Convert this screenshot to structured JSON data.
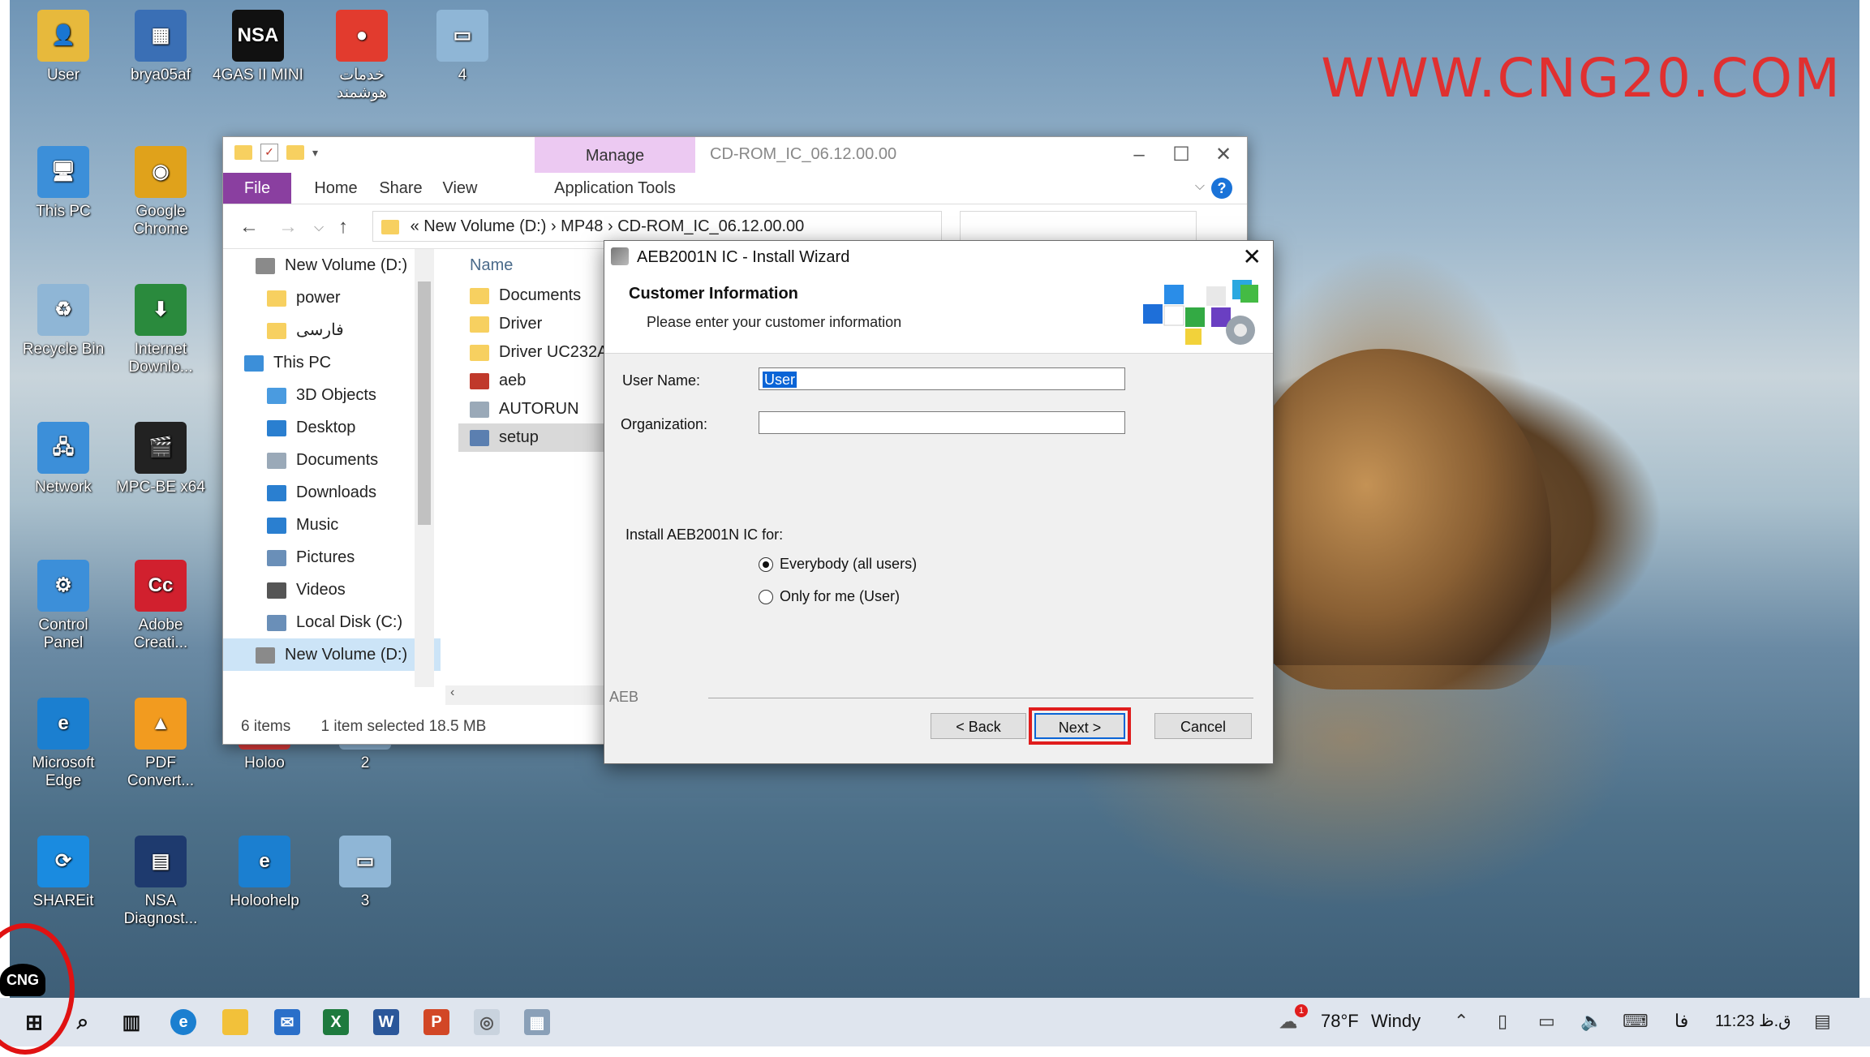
{
  "watermark": "WWW.CNG20.COM",
  "desktop": {
    "icons": [
      {
        "label": "User",
        "color": "#e7b93c",
        "glyph": "👤"
      },
      {
        "label": "brya05af",
        "color": "#3a6fb5",
        "glyph": "▦"
      },
      {
        "label": "4GAS II MINI",
        "color": "#111111",
        "glyph": "NSA"
      },
      {
        "label": "خدمات هوشمند",
        "color": "#e23b2e",
        "glyph": "●"
      },
      {
        "label": "4",
        "color": "#8fb6d6",
        "glyph": "▭"
      },
      {
        "label": "This PC",
        "color": "#3c8fd9",
        "glyph": "🖥"
      },
      {
        "label": "Google Chrome",
        "color": "#e0a21b",
        "glyph": "◉"
      },
      {
        "label": "Recycle Bin",
        "color": "#8fb6d6",
        "glyph": "♻"
      },
      {
        "label": "Internet Downlo...",
        "color": "#2a8a3d",
        "glyph": "⬇"
      },
      {
        "label": "Network",
        "color": "#3c8fd9",
        "glyph": "🖧"
      },
      {
        "label": "MPC-BE x64",
        "color": "#222222",
        "glyph": "🎬"
      },
      {
        "label": "Control Panel",
        "color": "#3c8fd9",
        "glyph": "⚙"
      },
      {
        "label": "Adobe Creati...",
        "color": "#d1202e",
        "glyph": "Cc"
      },
      {
        "label": "Microsoft Edge",
        "color": "#1b7fd0",
        "glyph": "e"
      },
      {
        "label": "PDF Convert...",
        "color": "#f29b1f",
        "glyph": "▲"
      },
      {
        "label": "Holoo",
        "color": "#e03c3c",
        "glyph": "●"
      },
      {
        "label": "2",
        "color": "#8fb6d6",
        "glyph": "▭"
      },
      {
        "label": "SHAREit",
        "color": "#1a8be0",
        "glyph": "⟳"
      },
      {
        "label": "NSA Diagnost...",
        "color": "#1e3a6e",
        "glyph": "▤"
      },
      {
        "label": "Holoohelp",
        "color": "#1b7fd0",
        "glyph": "e"
      },
      {
        "label": "3",
        "color": "#8fb6d6",
        "glyph": "▭"
      }
    ]
  },
  "explorer": {
    "title": "CD-ROM_IC_06.12.00.00",
    "manage_tab": "Manage",
    "ribbon_tabs": [
      "File",
      "Home",
      "Share",
      "View",
      "Application Tools"
    ],
    "address": "«  New Volume (D:)  ›  MP48  ›  CD-ROM_IC_06.12.00.00",
    "nav_items": [
      {
        "label": "New Volume (D:)",
        "color": "#8a8a8a"
      },
      {
        "label": "power",
        "color": "#f7d060"
      },
      {
        "label": "فارسی",
        "color": "#f7d060"
      },
      {
        "label": "This PC",
        "color": "#3c8fd9"
      },
      {
        "label": "3D Objects",
        "color": "#4a9be0"
      },
      {
        "label": "Desktop",
        "color": "#2a7fd0"
      },
      {
        "label": "Documents",
        "color": "#9aa9b8"
      },
      {
        "label": "Downloads",
        "color": "#2a7fd0"
      },
      {
        "label": "Music",
        "color": "#2a7fd0"
      },
      {
        "label": "Pictures",
        "color": "#6a8fb8"
      },
      {
        "label": "Videos",
        "color": "#555555"
      },
      {
        "label": "Local Disk (C:)",
        "color": "#6a8fb8"
      },
      {
        "label": "New Volume (D:)",
        "color": "#8a8a8a"
      }
    ],
    "column_name": "Name",
    "files": [
      {
        "label": "Documents",
        "color": "#f7d060"
      },
      {
        "label": "Driver",
        "color": "#f7d060"
      },
      {
        "label": "Driver UC232A",
        "color": "#f7d060"
      },
      {
        "label": "aeb",
        "color": "#c0392b"
      },
      {
        "label": "AUTORUN",
        "color": "#9aa9b8"
      },
      {
        "label": "setup",
        "color": "#5b7fb0"
      }
    ],
    "status_items": "6 items",
    "status_selected": "1 item selected  18.5 MB"
  },
  "wizard": {
    "title": "AEB2001N IC - Install Wizard",
    "heading": "Customer Information",
    "subheading": "Please enter your customer information",
    "user_name_label": "User Name:",
    "user_name_value": "User",
    "organization_label": "Organization:",
    "organization_value": "",
    "install_for_label": "Install AEB2001N IC for:",
    "option_everybody": "Everybody (all users)",
    "option_only_me": "Only for me (User)",
    "brand": "AEB",
    "back_label": "< Back",
    "next_label": "Next >",
    "cancel_label": "Cancel"
  },
  "taskbar": {
    "weather_temp": "78°F",
    "weather_text": "Windy",
    "lang": "فا",
    "time": "11:23 ق.ظ",
    "notification_count": "1"
  },
  "cng_badge": "CNG"
}
